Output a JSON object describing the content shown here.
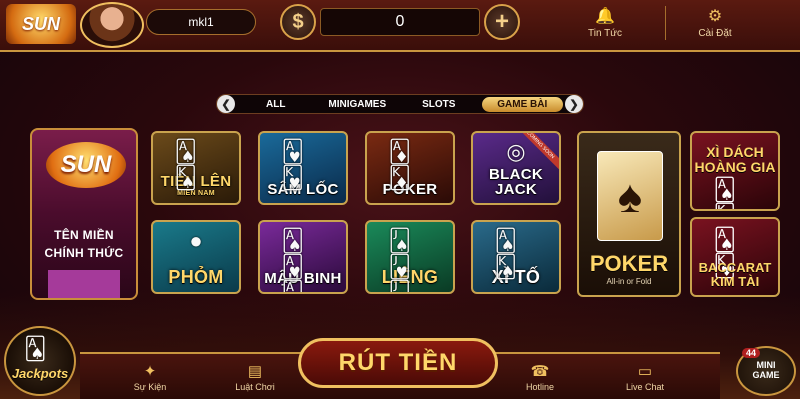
{
  "header": {
    "logo_text": "SUN",
    "username": "mkl1",
    "currency_symbol": "$",
    "balance": "0",
    "add_symbol": "+",
    "news_label": "Tin Tức",
    "settings_label": "Cài Đặt"
  },
  "tabs": {
    "prev_arrow": "❮",
    "next_arrow": "❯",
    "items": [
      {
        "label": "ALL"
      },
      {
        "label": "MINIGAMES"
      },
      {
        "label": "SLOTS"
      },
      {
        "label": "GAME BÀI"
      }
    ],
    "active": "GAME BÀI"
  },
  "promo": {
    "logo": "SUN",
    "line1": "TÊN MIỀN",
    "line2": "CHÍNH THỨC"
  },
  "games": {
    "tien_len": {
      "label": "TIẾN LÊN",
      "sub": "MIỀN NAM"
    },
    "sam_loc": {
      "label": "SÂM LỐC"
    },
    "poker_small": {
      "label": "POKER"
    },
    "black_jack": {
      "label": "BLACK JACK",
      "badge": "COMING SOON"
    },
    "phom": {
      "label": "PHỎM"
    },
    "mau_binh": {
      "label": "MẬU BINH"
    },
    "lieng": {
      "label": "LIÊNG"
    },
    "xi_to": {
      "label": "XÌ TỐ"
    },
    "poker_tall": {
      "label": "POKER",
      "sub": "All-in or Fold"
    },
    "xi_dach": {
      "label": "XÌ DÁCH HOÀNG GIA"
    },
    "baccarat": {
      "label": "BACCARAT KIM TÀI"
    }
  },
  "jackpot": {
    "label": "Jackpots"
  },
  "bottom": {
    "events": "Sự Kiện",
    "rules": "Luật Chơi",
    "withdraw": "RÚT TIỀN",
    "hotline": "Hotline",
    "live_chat": "Live Chat"
  },
  "minigame": {
    "badge": "44",
    "label_line1": "MINI",
    "label_line2": "GAME"
  }
}
